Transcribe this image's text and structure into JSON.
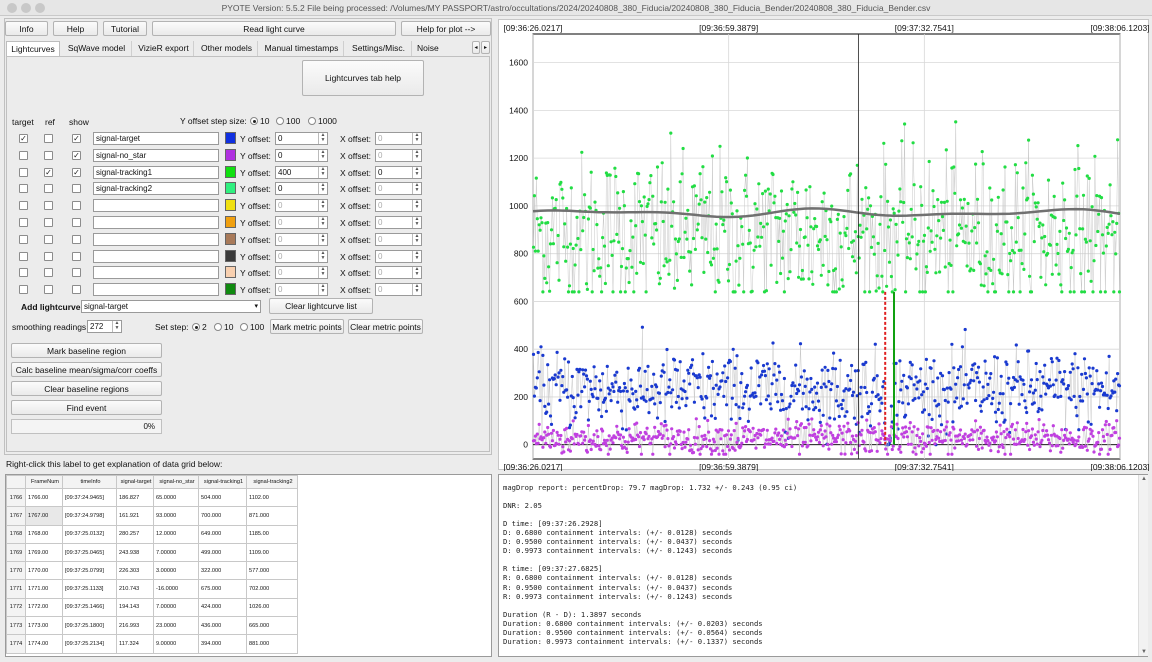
{
  "window": {
    "title": "PYOTE Version: 5.5.2  File being processed: /Volumes/MY PASSPORT/astro/occultations/2024/20240808_380_Fiducia/20240808_380_Fiducia_Bender/20240808_380_Fiducia_Bender.csv"
  },
  "toolbar": {
    "info": "Info",
    "help": "Help",
    "tutorial": "Tutorial",
    "read": "Read light curve",
    "help_plot": "Help for plot -->"
  },
  "tabs": [
    "Lightcurves",
    "SqWave model",
    "VizieR export",
    "Other models",
    "Manual timestamps",
    "Settings/Misc.",
    "Noise analysis/"
  ],
  "lc_tab_help": "Lightcurves tab help",
  "headers": {
    "target": "target",
    "ref": "ref",
    "show": "show",
    "yoff_step": "Y offset step size:"
  },
  "yoff_steps": [
    "10",
    "100",
    "1000"
  ],
  "row_labels": {
    "y_offset": "Y offset:",
    "x_offset": "X offset:"
  },
  "rows": [
    {
      "target": "✓",
      "ref": "",
      "show": "✓",
      "name": "signal-target",
      "color": "#1030e0",
      "y": "0",
      "x": "0",
      "enabled": true
    },
    {
      "target": "",
      "ref": "",
      "show": "✓",
      "name": "signal-no_star",
      "color": "#b030e0",
      "y": "0",
      "x": "0",
      "enabled": true
    },
    {
      "target": "",
      "ref": "✓",
      "show": "✓",
      "name": "signal-tracking1",
      "color": "#10e010",
      "y": "400",
      "x": "0",
      "enabled": true
    },
    {
      "target": "",
      "ref": "",
      "show": "",
      "name": "signal-tracking2",
      "color": "#30f080",
      "y": "0",
      "x": "0",
      "enabled": true
    },
    {
      "target": "",
      "ref": "",
      "show": "",
      "name": "",
      "color": "#f0e010",
      "y": "0",
      "x": "0",
      "enabled": false
    },
    {
      "target": "",
      "ref": "",
      "show": "",
      "name": "",
      "color": "#f0a010",
      "y": "0",
      "x": "0",
      "enabled": false
    },
    {
      "target": "",
      "ref": "",
      "show": "",
      "name": "",
      "color": "#a87a5a",
      "y": "0",
      "x": "0",
      "enabled": false
    },
    {
      "target": "",
      "ref": "",
      "show": "",
      "name": "",
      "color": "#3a3a3a",
      "y": "0",
      "x": "0",
      "enabled": false
    },
    {
      "target": "",
      "ref": "",
      "show": "",
      "name": "",
      "color": "#f8d0b0",
      "y": "0",
      "x": "0",
      "enabled": false
    },
    {
      "target": "",
      "ref": "",
      "show": "",
      "name": "",
      "color": "#108a10",
      "y": "0",
      "x": "0",
      "enabled": false
    }
  ],
  "add_lc": {
    "label": "Add lightcurve",
    "value": "signal-target",
    "clear": "Clear lightcurve list"
  },
  "smoothing": {
    "label": "smoothing readings",
    "value": "272"
  },
  "set_step": {
    "label": "Set step:",
    "options": [
      "2",
      "10",
      "100"
    ]
  },
  "metric": {
    "mark": "Mark metric points",
    "clear": "Clear metric points"
  },
  "actions": {
    "mark_baseline": "Mark baseline region",
    "calc_baseline": "Calc baseline mean/sigma/corr coeffs",
    "clear_baseline": "Clear baseline regions",
    "find_event": "Find event",
    "progress_text": "0%",
    "progress": 0
  },
  "grid_hint": "Right-click this label to get explanation of data grid below:",
  "grid": {
    "columns": [
      "FrameNum",
      "timeInfo",
      "signal-target",
      "signal-no_star",
      "signal-tracking1",
      "signal-tracking2"
    ],
    "rows": [
      [
        "1766",
        "1766.00",
        "[09:37:24.9465]",
        "186.827",
        "65.0000",
        "504.000",
        "1102.00"
      ],
      [
        "1767",
        "1767.00",
        "[09:37:24.9798]",
        "161.921",
        "93.0000",
        "700.000",
        "871.000"
      ],
      [
        "1768",
        "1768.00",
        "[09:37:25.0132]",
        "280.257",
        "12.0000",
        "649.000",
        "1185.00"
      ],
      [
        "1769",
        "1769.00",
        "[09:37:25.0465]",
        "243.938",
        "7.00000",
        "499.000",
        "1109.00"
      ],
      [
        "1770",
        "1770.00",
        "[09:37:25.0799]",
        "226.303",
        "3.00000",
        "322.000",
        "577.000"
      ],
      [
        "1771",
        "1771.00",
        "[09:37:25.1133]",
        "210.743",
        "-16.0000",
        "675.000",
        "702.000"
      ],
      [
        "1772",
        "1772.00",
        "[09:37:25.1466]",
        "194.143",
        "7.00000",
        "424.000",
        "1026.00"
      ],
      [
        "1773",
        "1773.00",
        "[09:37:25.1800]",
        "216.993",
        "23.0000",
        "436.000",
        "665.000"
      ],
      [
        "1774",
        "1774.00",
        "[09:37:25.2134]",
        "117.324",
        "9.00000",
        "394.000",
        "881.000"
      ]
    ]
  },
  "report": [
    "magDrop report: percentDrop: 79.7 magDrop: 1.732 +/- 0.243 (0.95 ci)",
    "",
    "DNR: 2.05",
    "",
    "D time: [09:37:26.2928]",
    "D: 0.6800 containment intervals: (+/- 0.0128) seconds",
    "D: 0.9500 containment intervals: (+/- 0.0437) seconds",
    "D: 0.9973 containment intervals: (+/- 0.1243) seconds",
    "",
    "R time: [09:37:27.6825]",
    "R: 0.6800 containment intervals: (+/- 0.0128) seconds",
    "R: 0.9500 containment intervals: (+/- 0.0437) seconds",
    "R: 0.9973 containment intervals: (+/- 0.1243) seconds",
    "",
    "Duration (R - D): 1.3897 seconds",
    "Duration: 0.6800 containment intervals: (+/- 0.0203) seconds",
    "Duration: 0.9500 containment intervals: (+/- 0.0564) seconds",
    "Duration: 0.9973 containment intervals: (+/- 0.1337) seconds"
  ],
  "chart_data": {
    "type": "scatter",
    "x_tick_labels": [
      "[09:36:26.0217]",
      "[09:36:59.3879]",
      "[09:37:32.7541]",
      "[09:38:06.1203]"
    ],
    "y_ticks": [
      0,
      200,
      400,
      600,
      800,
      1000,
      1200,
      1400,
      1600
    ],
    "ylim": [
      -60,
      1720
    ],
    "frame_range": [
      0,
      3000
    ],
    "event_frames": {
      "D": 1800,
      "R": 1845
    },
    "cursor_frame": 1663,
    "grid": true,
    "series": [
      {
        "name": "signal-tracking1",
        "color": "#22dd44",
        "mean": 880,
        "sd": 170,
        "offset": 400
      },
      {
        "name": "signal-target",
        "color": "#1a3ad0",
        "mean": 230,
        "sd": 80,
        "offset": 0
      },
      {
        "name": "signal-no_star",
        "color": "#c040e0",
        "mean": 25,
        "sd": 35,
        "offset": 0
      }
    ],
    "smoothed_line": {
      "color": "#707070",
      "level": 970
    },
    "markers": {
      "D": "#e02020",
      "R": "#10a010"
    }
  }
}
